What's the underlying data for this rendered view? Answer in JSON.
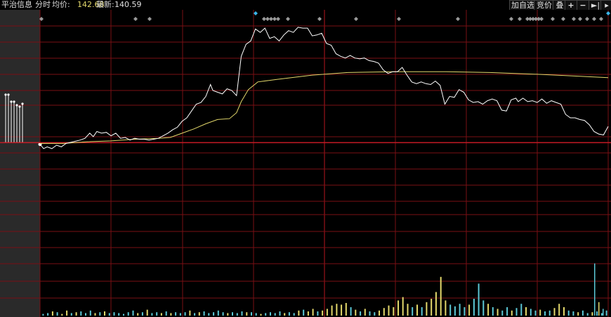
{
  "header": {
    "stock_name": "平治信息",
    "mode_label": "分时",
    "avg_label": "均价:",
    "avg_value": "142.68",
    "last_label": "最新:",
    "last_value": "140.59"
  },
  "toolbar": {
    "watchlist_label": "加自选",
    "bid_label": "竞价",
    "overlay_label": "叠",
    "zoom_in_icon": "plus-icon",
    "zoom_out_icon": "minus-icon",
    "end_icon": "jump-to-end-icon",
    "more_icon": "triangle-right-icon"
  },
  "colors": {
    "background": "#000000",
    "grid": "#7a0f14",
    "baseline": "#c51a24",
    "price_line": "#ffffff",
    "avg_line": "#e3d86b",
    "volume_up": "#e3d86b",
    "volume_down": "#5bc8d6",
    "auction_panel": "#2a2a2a",
    "event_marker": "#9a9a9a",
    "event_marker_highlight": "#3ab4e8"
  },
  "chart_data": {
    "type": "line",
    "title": "",
    "xlabel": "",
    "ylabel": "",
    "x_range": [
      0,
      240
    ],
    "price_range": [
      130.0,
      152.0
    ],
    "prev_close": 138.1,
    "grid": true,
    "series": [
      {
        "key": "price",
        "values": [
          [
            0,
            137.9
          ],
          [
            3,
            137.4
          ],
          [
            6,
            137.6
          ],
          [
            10,
            137.4
          ],
          [
            14,
            137.8
          ],
          [
            18,
            137.6
          ],
          [
            22,
            138.0
          ],
          [
            28,
            138.2
          ],
          [
            34,
            138.4
          ],
          [
            38,
            138.6
          ],
          [
            42,
            139.2
          ],
          [
            45,
            138.8
          ],
          [
            48,
            139.4
          ],
          [
            52,
            139.2
          ],
          [
            56,
            139.3
          ],
          [
            60,
            138.9
          ],
          [
            64,
            139.2
          ],
          [
            68,
            138.6
          ],
          [
            72,
            138.7
          ],
          [
            76,
            138.4
          ],
          [
            80,
            138.6
          ],
          [
            84,
            138.5
          ],
          [
            88,
            138.5
          ],
          [
            92,
            138.4
          ],
          [
            96,
            138.5
          ],
          [
            100,
            138.6
          ],
          [
            104,
            138.9
          ],
          [
            108,
            139.2
          ],
          [
            112,
            139.6
          ],
          [
            116,
            139.9
          ],
          [
            120,
            140.6
          ],
          [
            124,
            141.0
          ],
          [
            128,
            141.8
          ],
          [
            132,
            142.6
          ],
          [
            136,
            142.8
          ],
          [
            140,
            143.5
          ],
          [
            144,
            144.9
          ],
          [
            146,
            144.2
          ],
          [
            150,
            144.0
          ],
          [
            154,
            143.8
          ],
          [
            158,
            144.4
          ],
          [
            162,
            144.2
          ],
          [
            166,
            143.6
          ],
          [
            170,
            148.2
          ],
          [
            174,
            149.6
          ],
          [
            178,
            150.0
          ],
          [
            182,
            151.4
          ],
          [
            186,
            151.0
          ],
          [
            190,
            151.5
          ],
          [
            194,
            150.3
          ],
          [
            198,
            150.5
          ],
          [
            202,
            150.0
          ],
          [
            206,
            150.7
          ],
          [
            210,
            151.2
          ],
          [
            214,
            151.0
          ],
          [
            218,
            151.6
          ],
          [
            222,
            151.5
          ],
          [
            226,
            151.5
          ],
          [
            230,
            150.6
          ],
          [
            234,
            150.7
          ],
          [
            238,
            150.9
          ],
          [
            242,
            149.7
          ],
          [
            246,
            149.5
          ],
          [
            250,
            148.5
          ],
          [
            254,
            148.2
          ],
          [
            258,
            148.0
          ],
          [
            262,
            148.3
          ],
          [
            266,
            148.0
          ],
          [
            270,
            147.9
          ],
          [
            274,
            148.0
          ],
          [
            278,
            147.7
          ],
          [
            282,
            147.6
          ],
          [
            286,
            147.4
          ],
          [
            290,
            146.6
          ],
          [
            294,
            146.2
          ],
          [
            298,
            146.4
          ],
          [
            302,
            146.4
          ],
          [
            306,
            146.9
          ],
          [
            310,
            146.0
          ],
          [
            314,
            145.2
          ],
          [
            318,
            145.0
          ],
          [
            322,
            145.2
          ],
          [
            326,
            145.0
          ],
          [
            330,
            144.9
          ],
          [
            334,
            145.3
          ],
          [
            338,
            144.8
          ],
          [
            342,
            142.6
          ],
          [
            346,
            143.5
          ],
          [
            350,
            143.4
          ],
          [
            354,
            144.3
          ],
          [
            358,
            144.0
          ],
          [
            362,
            143.1
          ],
          [
            366,
            142.8
          ],
          [
            370,
            142.9
          ],
          [
            374,
            142.6
          ],
          [
            378,
            143.0
          ],
          [
            382,
            143.2
          ],
          [
            386,
            143.0
          ],
          [
            390,
            141.9
          ],
          [
            394,
            141.8
          ],
          [
            398,
            143.1
          ],
          [
            402,
            143.3
          ],
          [
            404,
            142.9
          ],
          [
            408,
            143.3
          ],
          [
            412,
            142.9
          ],
          [
            416,
            143.0
          ],
          [
            420,
            142.8
          ],
          [
            424,
            143.2
          ],
          [
            428,
            142.7
          ],
          [
            432,
            143.0
          ],
          [
            436,
            142.8
          ],
          [
            440,
            142.6
          ],
          [
            444,
            141.4
          ],
          [
            448,
            141.0
          ],
          [
            452,
            141.0
          ],
          [
            456,
            140.8
          ],
          [
            460,
            140.7
          ],
          [
            464,
            140.2
          ],
          [
            468,
            139.4
          ],
          [
            472,
            139.1
          ],
          [
            476,
            139.0
          ],
          [
            480,
            140.0
          ]
        ]
      },
      {
        "key": "avg",
        "values": [
          [
            0,
            138.0
          ],
          [
            20,
            138.0
          ],
          [
            40,
            138.2
          ],
          [
            60,
            138.3
          ],
          [
            80,
            138.5
          ],
          [
            100,
            138.6
          ],
          [
            110,
            138.7
          ],
          [
            120,
            139.2
          ],
          [
            130,
            139.7
          ],
          [
            140,
            140.3
          ],
          [
            150,
            140.8
          ],
          [
            160,
            140.9
          ],
          [
            166,
            141.6
          ],
          [
            170,
            142.9
          ],
          [
            176,
            144.3
          ],
          [
            184,
            145.2
          ],
          [
            200,
            145.5
          ],
          [
            230,
            146.0
          ],
          [
            260,
            146.3
          ],
          [
            300,
            146.4
          ],
          [
            340,
            146.4
          ],
          [
            380,
            146.3
          ],
          [
            420,
            146.1
          ],
          [
            450,
            145.9
          ],
          [
            480,
            145.7
          ]
        ]
      }
    ],
    "volume": {
      "max": 100,
      "bars": [
        [
          1,
          2,
          "d"
        ],
        [
          3,
          3,
          "d"
        ],
        [
          5,
          5,
          "u"
        ],
        [
          7,
          4,
          "d"
        ],
        [
          9,
          2,
          "u"
        ],
        [
          11,
          6,
          "u"
        ],
        [
          13,
          3,
          "d"
        ],
        [
          15,
          4,
          "u"
        ],
        [
          17,
          5,
          "d"
        ],
        [
          19,
          3,
          "d"
        ],
        [
          21,
          6,
          "d"
        ],
        [
          23,
          3,
          "u"
        ],
        [
          25,
          4,
          "d"
        ],
        [
          27,
          5,
          "u"
        ],
        [
          29,
          3,
          "d"
        ],
        [
          31,
          4,
          "d"
        ],
        [
          33,
          3,
          "d"
        ],
        [
          35,
          2,
          "d"
        ],
        [
          37,
          4,
          "d"
        ],
        [
          39,
          6,
          "d"
        ],
        [
          41,
          3,
          "u"
        ],
        [
          43,
          4,
          "d"
        ],
        [
          45,
          7,
          "u"
        ],
        [
          47,
          3,
          "d"
        ],
        [
          49,
          4,
          "d"
        ],
        [
          51,
          3,
          "u"
        ],
        [
          53,
          5,
          "d"
        ],
        [
          55,
          3,
          "u"
        ],
        [
          57,
          4,
          "d"
        ],
        [
          59,
          3,
          "d"
        ],
        [
          61,
          4,
          "d"
        ],
        [
          63,
          6,
          "u"
        ],
        [
          65,
          3,
          "d"
        ],
        [
          67,
          4,
          "u"
        ],
        [
          69,
          5,
          "d"
        ],
        [
          71,
          3,
          "d"
        ],
        [
          73,
          4,
          "d"
        ],
        [
          75,
          6,
          "d"
        ],
        [
          77,
          4,
          "d"
        ],
        [
          79,
          3,
          "u"
        ],
        [
          81,
          4,
          "d"
        ],
        [
          83,
          3,
          "d"
        ],
        [
          85,
          5,
          "d"
        ],
        [
          87,
          4,
          "u"
        ],
        [
          89,
          4,
          "d"
        ],
        [
          91,
          3,
          "d"
        ],
        [
          93,
          2,
          "u"
        ],
        [
          95,
          3,
          "d"
        ],
        [
          97,
          4,
          "d"
        ],
        [
          99,
          3,
          "d"
        ],
        [
          101,
          5,
          "d"
        ],
        [
          103,
          3,
          "u"
        ],
        [
          105,
          4,
          "d"
        ],
        [
          107,
          3,
          "d"
        ],
        [
          109,
          6,
          "u"
        ],
        [
          111,
          7,
          "d"
        ],
        [
          113,
          5,
          "u"
        ],
        [
          115,
          8,
          "u"
        ],
        [
          117,
          5,
          "d"
        ],
        [
          119,
          6,
          "u"
        ],
        [
          121,
          8,
          "u"
        ],
        [
          123,
          12,
          "u"
        ],
        [
          125,
          14,
          "u"
        ],
        [
          127,
          13,
          "u"
        ],
        [
          129,
          15,
          "u"
        ],
        [
          131,
          10,
          "d"
        ],
        [
          133,
          7,
          "u"
        ],
        [
          135,
          5,
          "d"
        ],
        [
          137,
          8,
          "u"
        ],
        [
          139,
          5,
          "d"
        ],
        [
          141,
          4,
          "d"
        ],
        [
          143,
          6,
          "u"
        ],
        [
          145,
          9,
          "u"
        ],
        [
          147,
          12,
          "u"
        ],
        [
          149,
          10,
          "u"
        ],
        [
          151,
          18,
          "u"
        ],
        [
          153,
          22,
          "u"
        ],
        [
          155,
          14,
          "u"
        ],
        [
          157,
          10,
          "d"
        ],
        [
          159,
          13,
          "u"
        ],
        [
          161,
          10,
          "d"
        ],
        [
          163,
          16,
          "u"
        ],
        [
          165,
          20,
          "u"
        ],
        [
          167,
          28,
          "u"
        ],
        [
          169,
          46,
          "u"
        ],
        [
          171,
          18,
          "u"
        ],
        [
          173,
          13,
          "d"
        ],
        [
          175,
          11,
          "d"
        ],
        [
          177,
          14,
          "d"
        ],
        [
          179,
          10,
          "d"
        ],
        [
          181,
          13,
          "u"
        ],
        [
          183,
          20,
          "d"
        ],
        [
          185,
          38,
          "d"
        ],
        [
          187,
          18,
          "d"
        ],
        [
          189,
          14,
          "u"
        ],
        [
          191,
          10,
          "d"
        ],
        [
          193,
          8,
          "u"
        ],
        [
          195,
          6,
          "d"
        ],
        [
          197,
          10,
          "d"
        ],
        [
          199,
          6,
          "u"
        ],
        [
          201,
          9,
          "d"
        ],
        [
          203,
          14,
          "d"
        ],
        [
          205,
          10,
          "u"
        ],
        [
          207,
          8,
          "d"
        ],
        [
          209,
          6,
          "d"
        ],
        [
          211,
          7,
          "u"
        ],
        [
          213,
          5,
          "d"
        ],
        [
          215,
          6,
          "d"
        ],
        [
          217,
          9,
          "u"
        ],
        [
          219,
          14,
          "u"
        ],
        [
          221,
          10,
          "u"
        ],
        [
          223,
          6,
          "d"
        ],
        [
          225,
          5,
          "d"
        ],
        [
          227,
          4,
          "u"
        ],
        [
          229,
          6,
          "d"
        ],
        [
          231,
          3,
          "d"
        ],
        [
          233,
          4,
          "u"
        ],
        [
          235,
          5,
          "d"
        ],
        [
          237,
          3,
          "d"
        ],
        [
          239,
          6,
          "d"
        ]
      ]
    }
  }
}
